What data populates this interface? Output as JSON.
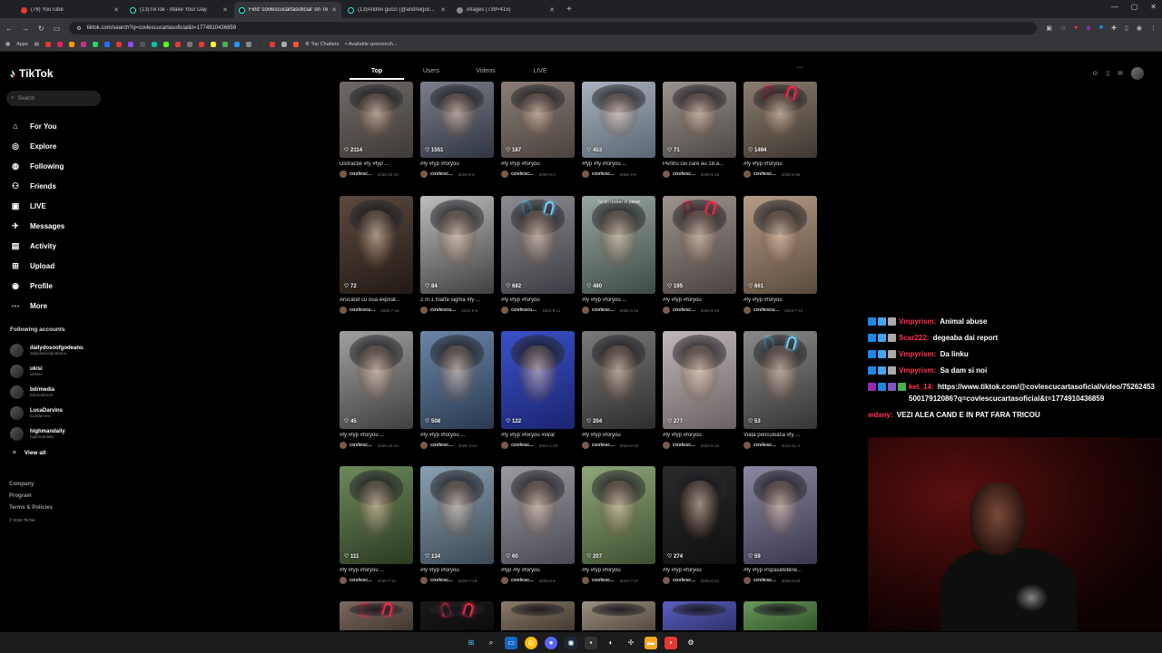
{
  "browser": {
    "tabs": [
      {
        "title": "(76) YouTube",
        "icon": "youtube-icon",
        "active": false
      },
      {
        "title": "(13)TikTok - Make Your Day",
        "icon": "tiktok-icon",
        "active": false
      },
      {
        "title": "Find 'covlescucartasoficial' on TikTok",
        "icon": "tiktok-icon",
        "active": true
      },
      {
        "title": "(13)Andrei gucci (@andreiguc...",
        "icon": "tiktok-icon",
        "active": false
      },
      {
        "title": "images (739×415)",
        "icon": "globe-icon",
        "active": false
      }
    ],
    "url": "tiktok.com/search?q=covlescucartasoficial&t=1774910436859",
    "bookmarks": {
      "apps_label": "Apps",
      "items": [
        "Top Chatters",
        "Available sponsorsh..."
      ]
    }
  },
  "sidebar": {
    "brand": "TikTok",
    "search_placeholder": "Search",
    "nav": [
      {
        "label": "For You",
        "icon": "home-icon"
      },
      {
        "label": "Explore",
        "icon": "compass-icon"
      },
      {
        "label": "Following",
        "icon": "following-icon"
      },
      {
        "label": "Friends",
        "icon": "friends-icon"
      },
      {
        "label": "LIVE",
        "icon": "live-icon"
      },
      {
        "label": "Messages",
        "icon": "messages-icon"
      },
      {
        "label": "Activity",
        "icon": "activity-icon"
      },
      {
        "label": "Upload",
        "icon": "upload-icon"
      },
      {
        "label": "Profile",
        "icon": "profile-icon"
      },
      {
        "label": "More",
        "icon": "more-icon"
      }
    ],
    "following_header": "Following accounts",
    "accounts": [
      {
        "name": "dailydosoofgodeanu",
        "handle": "dailydoseofgodeanu"
      },
      {
        "name": "ukisi",
        "handle": "ukisiss"
      },
      {
        "name": "bdrmedia",
        "handle": "bdrmediaro2"
      },
      {
        "name": "LucaDarvins",
        "handle": "lucadarvins"
      },
      {
        "name": "highmandally",
        "handle": "highmandally"
      }
    ],
    "view_all": "View all",
    "footer": [
      "Company",
      "Program",
      "Terms & Policies"
    ],
    "copyright": "© 2026 TikTok"
  },
  "content_tabs": [
    "Top",
    "Users",
    "Videos",
    "LIVE"
  ],
  "videos": [
    [
      {
        "likes": "2114",
        "caption": "Distracție #fy #fyp ...",
        "author": "covlesc...",
        "date": "2025-10-14"
      },
      {
        "likes": "1551",
        "caption": "#fy #fyp #foryou",
        "author": "covlesc...",
        "date": "2024-6-8"
      },
      {
        "likes": "187",
        "caption": "#fy #fyp #foryou",
        "author": "covlesc...",
        "date": "2024-9-3"
      },
      {
        "likes": "453",
        "caption": "#fyp #fy #foryou ...",
        "author": "covlesc...",
        "date": "2025-4-6"
      },
      {
        "likes": "71",
        "caption": "Pentru cei care au 18 a...",
        "author": "covlesc...",
        "date": "2025-6-16"
      },
      {
        "likes": "1494",
        "caption": "#fy #fyp #foryou",
        "author": "covlesc...",
        "date": "2025-8-25"
      }
    ],
    [
      {
        "likes": "72",
        "caption": "Arucând cu ouă expirat...",
        "author": "covlescu...",
        "date": "2025-7-16"
      },
      {
        "likes": "84",
        "caption": "2 în 1 foarte sigma #fy ...",
        "author": "covlescu...",
        "date": "2024-9-8"
      },
      {
        "likes": "682",
        "caption": "#fy #fyp #foryou",
        "author": "covlescu...",
        "date": "2023-9-11"
      },
      {
        "likes": "480",
        "caption": "#fy #fyp #foryou ...",
        "author": "covlesc...",
        "date": "2025-3-16",
        "overlay": "Tu un rocker in pasai"
      },
      {
        "likes": "195",
        "caption": "#fy #fyp #foryou",
        "author": "covlesc...",
        "date": "2024-6-29"
      },
      {
        "likes": "661",
        "caption": "#fy #fyp #foryou",
        "author": "covlescu...",
        "date": "2024-7-11"
      }
    ],
    [
      {
        "likes": "45",
        "caption": "#fy #fyp #foryou ...",
        "author": "covlesc...",
        "date": "2025-10-12"
      },
      {
        "likes": "508",
        "caption": "#fy #fyp #foryou ...",
        "author": "covlesc...",
        "date": "2025-3-24"
      },
      {
        "likes": "122",
        "caption": "#fy #fyp #foryou #viral",
        "author": "covlesc...",
        "date": "2024-1-19"
      },
      {
        "likes": "204",
        "caption": "#fy #fyp #foryou",
        "author": "covlesc...",
        "date": "2024-8-10"
      },
      {
        "likes": "277",
        "caption": "#fy #fyp #foryou",
        "author": "covlesc...",
        "date": "2024-5-15"
      },
      {
        "likes": "53",
        "caption": "Viața periculoasă #fy ...",
        "author": "covlesc...",
        "date": "2024-11-4"
      }
    ],
    [
      {
        "likes": "111",
        "caption": "#fy #fyp #foryou ...",
        "author": "covlesc...",
        "date": "2025-7-31"
      },
      {
        "likes": "134",
        "caption": "#fy #fyp #foryou",
        "author": "covlesc...",
        "date": "2024-7-19"
      },
      {
        "likes": "60",
        "caption": "#fyp #fy #foryou",
        "author": "covlesc...",
        "date": "2025-3-9"
      },
      {
        "likes": "207",
        "caption": "#fy #fyp #foryou",
        "author": "covlesc...",
        "date": "2024-7-27"
      },
      {
        "likes": "274",
        "caption": "#fy #fyp #foryou",
        "author": "covlesc...",
        "date": "2025-6-21"
      },
      {
        "likes": "59",
        "caption": "#fy #fyp #Spasidebine...",
        "author": "covlesc...",
        "date": "2025-6-23"
      }
    ]
  ],
  "chat": [
    {
      "user": "Vmpyrism:",
      "text": "Animal abuse"
    },
    {
      "user": "Scar222:",
      "text": "degeaba dai report"
    },
    {
      "user": "Vmpyrism:",
      "text": "Da linku"
    },
    {
      "user": "Vmpyrism:",
      "text": "Sa dam si noi"
    },
    {
      "user": "ket_14:",
      "text": "https://www.tiktok.com/@covlescucartasoficial/video/7526245350017912086?q=covlescucartasoficial&t=1774910436859"
    },
    {
      "user": "wdany:",
      "text": "VEZI ALEA CAND E IN PAT FARA TRICOU"
    }
  ],
  "colors": {
    "accent": "#fe2c55",
    "cyan": "#25f4ee",
    "chat_user": "#ff3355"
  }
}
